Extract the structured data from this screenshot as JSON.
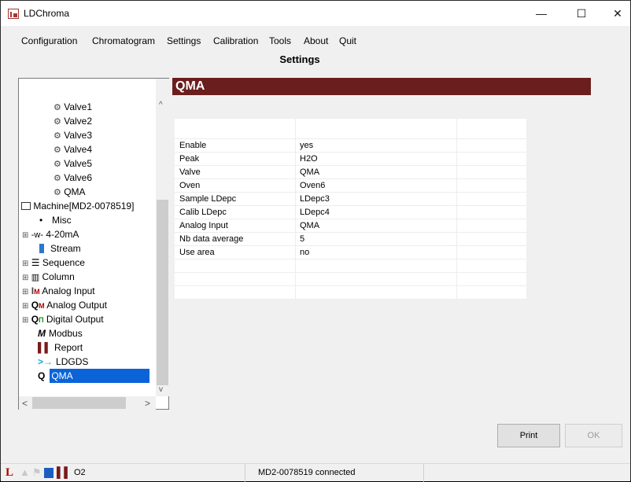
{
  "window": {
    "title": "LDChroma",
    "controls": {
      "minimize": "—",
      "maximize": "☐",
      "close": "✕"
    }
  },
  "menu": [
    "Configuration",
    "Chromatogram",
    "Settings",
    "Calibration",
    "Tools",
    "About",
    "Quit"
  ],
  "page_title": "Settings",
  "tree": {
    "valves": [
      "Valve1",
      "Valve2",
      "Valve3",
      "Valve4",
      "Valve5",
      "Valve6",
      "QMA"
    ],
    "machine": "Machine[MD2-0078519]",
    "items": [
      "Misc",
      "4-20mA",
      "Stream",
      "Sequence",
      "Column",
      "Analog Input",
      "Analog Output",
      "Digital Output",
      "Modbus",
      "Report",
      "LDGDS",
      "QMA"
    ],
    "selected": "QMA",
    "expanders": {
      "plus": "⊞",
      "bullet": "•"
    }
  },
  "section_header": "QMA",
  "table": {
    "rows": [
      {
        "label": "Enable",
        "value": "yes"
      },
      {
        "label": "Peak",
        "value": "H2O"
      },
      {
        "label": "Valve",
        "value": "QMA"
      },
      {
        "label": "Oven",
        "value": "Oven6"
      },
      {
        "label": "Sample LDepc",
        "value": "LDepc3"
      },
      {
        "label": "Calib LDepc",
        "value": "LDepc4"
      },
      {
        "label": "Analog Input",
        "value": "QMA"
      },
      {
        "label": "Nb data average",
        "value": "5"
      },
      {
        "label": "Use area",
        "value": "no"
      }
    ]
  },
  "buttons": {
    "print": "Print",
    "ok": "OK"
  },
  "status": {
    "gas": "O2",
    "connection": "MD2-0078519 connected",
    "logo_letter": "L"
  },
  "colors": {
    "header": "#6b1e1e",
    "selection": "#0a64d8",
    "accent_red": "#b00000"
  }
}
